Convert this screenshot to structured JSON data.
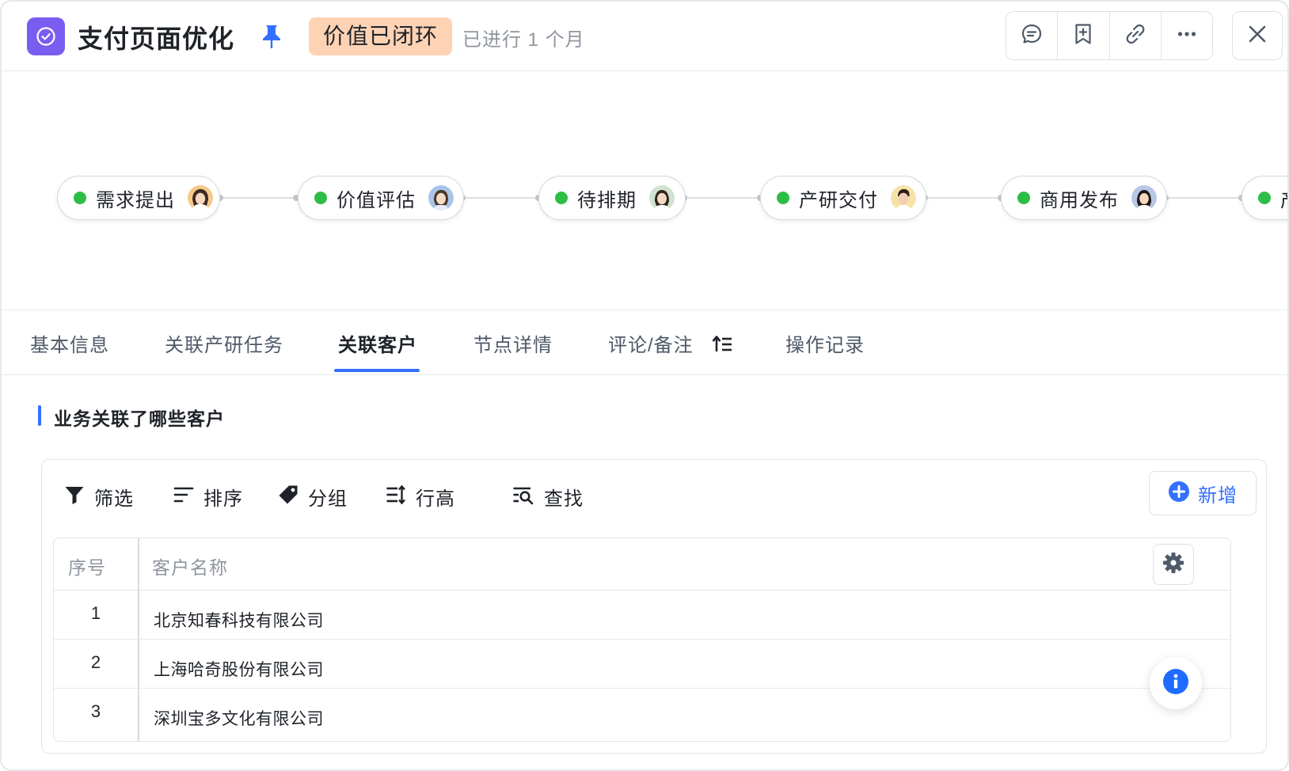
{
  "header": {
    "title": "支付页面优化",
    "status_badge": "价值已闭环",
    "duration": "已进行 1 个月",
    "icons": [
      "check-circle-icon",
      "pin-icon",
      "comment-icon",
      "bookmark-add-icon",
      "link-icon",
      "more-icon",
      "close-icon"
    ],
    "colors": {
      "app_icon": "#7b5cf0",
      "badge_bg": "#fdd3b4",
      "pin": "#3370ff"
    }
  },
  "flow": {
    "nodes": [
      {
        "label": "需求提出",
        "status": "done"
      },
      {
        "label": "价值评估",
        "status": "done"
      },
      {
        "label": "待排期",
        "status": "done"
      },
      {
        "label": "产研交付",
        "status": "done"
      },
      {
        "label": "商用发布",
        "status": "done"
      },
      {
        "label": "产",
        "status": "done"
      }
    ],
    "status_color": "#2ebd47"
  },
  "tabs": [
    {
      "label": "基本信息",
      "active": false
    },
    {
      "label": "关联产研任务",
      "active": false
    },
    {
      "label": "关联客户",
      "active": true
    },
    {
      "label": "节点详情",
      "active": false
    },
    {
      "label": "评论/备注",
      "active": false
    },
    {
      "label": "操作记录",
      "active": false
    }
  ],
  "section": {
    "title": "业务关联了哪些客户"
  },
  "toolbar": {
    "filter": "筛选",
    "sort": "排序",
    "group": "分组",
    "row_height": "行高",
    "search": "查找",
    "add": "新增"
  },
  "table": {
    "columns": [
      "序号",
      "客户名称"
    ],
    "rows": [
      {
        "index": "1",
        "name": "北京知春科技有限公司"
      },
      {
        "index": "2",
        "name": "上海哈奇股份有限公司"
      },
      {
        "index": "3",
        "name": "深圳宝多文化有限公司"
      }
    ]
  },
  "accent_color": "#3370ff"
}
